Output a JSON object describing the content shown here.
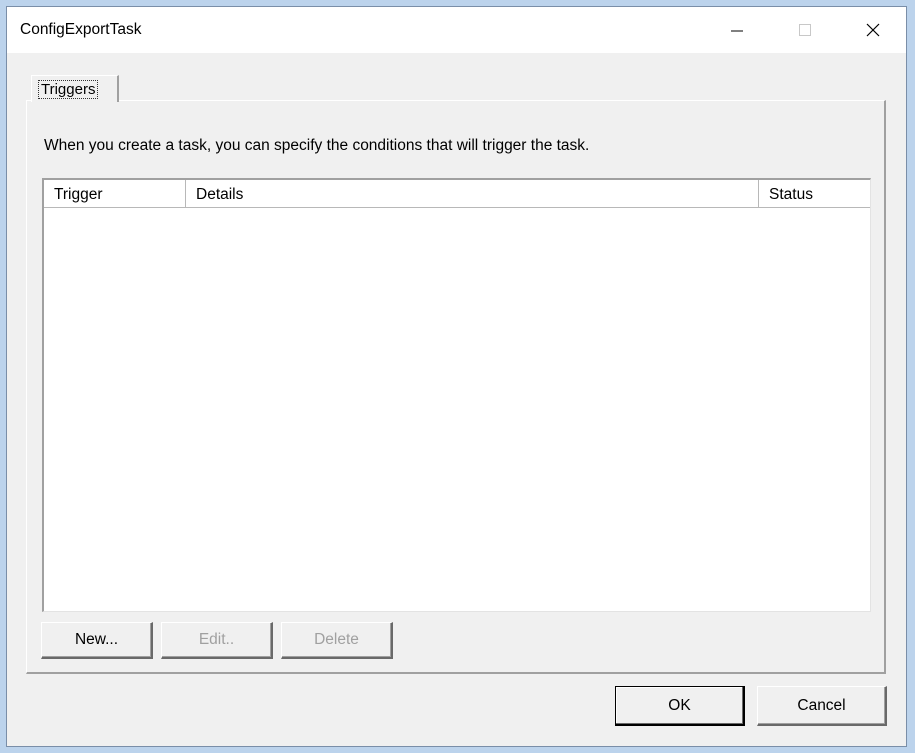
{
  "window": {
    "title": "ConfigExportTask",
    "controls": {
      "minimize": "minimize-icon",
      "maximize": "maximize-icon",
      "close": "close-icon"
    }
  },
  "tabs": [
    {
      "label": "Triggers",
      "active": true
    }
  ],
  "triggers_page": {
    "description": "When you create a task, you can specify the conditions that will trigger the task.",
    "list": {
      "columns": [
        "Trigger",
        "Details",
        "Status"
      ],
      "rows": []
    },
    "buttons": {
      "new": "New...",
      "edit": "Edit..",
      "delete": "Delete"
    }
  },
  "dialog_buttons": {
    "ok": "OK",
    "cancel": "Cancel"
  },
  "colors": {
    "dialog_bg": "#f0f0f0",
    "titlebar_bg": "#ffffff",
    "desktop_bg": "#bcd3ec",
    "disabled_text": "#a0a0a0"
  }
}
